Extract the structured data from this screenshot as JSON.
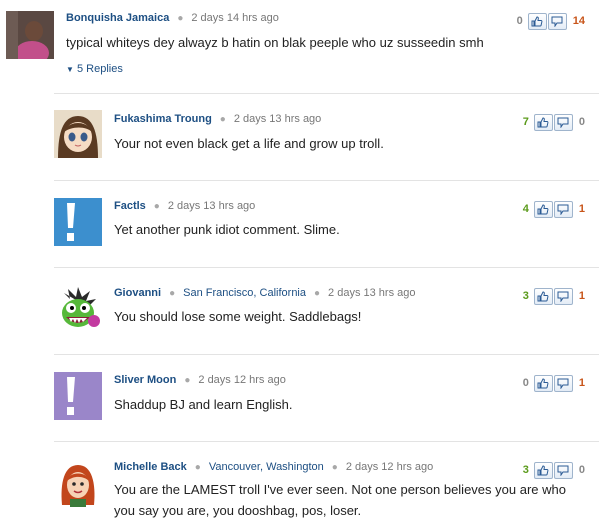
{
  "comments": [
    {
      "name": "Bonquisha Jamaica",
      "location": "",
      "time": "2 days 14 hrs ago",
      "text": "typical whiteys dey alwayz b hatin on blak peeple who uz susseedin smh",
      "up": "0",
      "down": "14",
      "replies": "5 Replies"
    },
    {
      "name": "Fukashima Troung",
      "location": "",
      "time": "2 days 13 hrs ago",
      "text": "Your not even black get a life and grow up troll.",
      "up": "7",
      "down": "0"
    },
    {
      "name": "Factls",
      "location": "",
      "time": "2 days 13 hrs ago",
      "text": "Yet another punk idiot comment. Slime.",
      "up": "4",
      "down": "1"
    },
    {
      "name": "Giovanni",
      "location": "San Francisco, California",
      "time": "2 days 13 hrs ago",
      "text": "You should lose some weight. Saddlebags!",
      "up": "3",
      "down": "1"
    },
    {
      "name": "Sliver Moon",
      "location": "",
      "time": "2 days 12 hrs ago",
      "text": "Shaddup BJ and learn English.",
      "up": "0",
      "down": "1"
    },
    {
      "name": "Michelle Back",
      "location": "Vancouver, Washington",
      "time": "2 days 12 hrs ago",
      "text": "You are the LAMEST troll I've ever seen. Not one person believes you are who you say you are, you dooshbag, pos, loser.",
      "up": "3",
      "down": "0"
    }
  ],
  "icons": {
    "thumbs_up": "thumbs-up-icon",
    "thumbs_down": "thumbs-down-icon",
    "expand": "triangle-down-icon"
  },
  "colors": {
    "link": "#1d4f83",
    "up": "#5a9a1a",
    "down": "#c8551a",
    "default_avatar": "#3c8fce",
    "default_avatar_purple": "#9a86c9"
  }
}
